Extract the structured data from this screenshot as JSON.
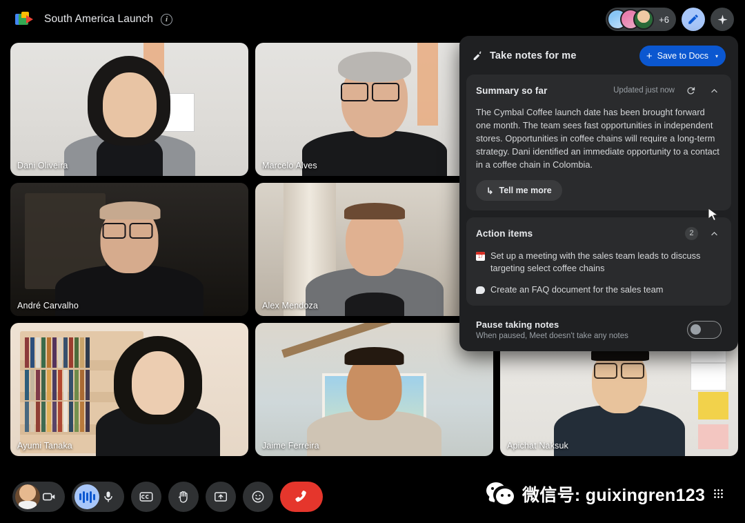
{
  "window": {
    "app_logo": "google-meet-logo",
    "title": "South America Launch",
    "info_icon": "info-icon"
  },
  "topbar": {
    "participant_overflow": "+6",
    "notes_toggle_icon": "notes-pen-icon",
    "gemini_icon": "sparkle-icon"
  },
  "grid": {
    "tiles": [
      {
        "name": "Dani Oliveira"
      },
      {
        "name": "Marcelo Alves"
      },
      {
        "name": "André Carvalho"
      },
      {
        "name": "Alex Mendoza"
      },
      {
        "name": "Ayumi Tanaka"
      },
      {
        "name": "Jaime Ferreira"
      },
      {
        "name": "Apichat Naksuk"
      }
    ]
  },
  "notes_panel": {
    "header_icon": "magic-pen-icon",
    "header_title": "Take notes for me",
    "save_button": {
      "plus": "+",
      "label": "Save to Docs",
      "caret": "▾"
    },
    "summary": {
      "title": "Summary so far",
      "updated": "Updated just now",
      "refresh_icon": "refresh-icon",
      "collapse_icon": "chevron-up-icon",
      "text": "The Cymbal Coffee launch date has been brought forward one month. The team sees fast opportunities in independent stores. Opportunities in coffee chains will require a long-term strategy. Dani identified an immediate opportunity to a contact in a coffee chain in Colombia.",
      "tell_me_more": {
        "arrow": "↳",
        "label": "Tell me more"
      }
    },
    "action_items": {
      "title": "Action items",
      "count": "2",
      "collapse_icon": "chevron-up-icon",
      "items": [
        {
          "icon": "calendar-icon",
          "day": "17",
          "text": "Set up a meeting with the sales team leads to discuss targeting select coffee chains"
        },
        {
          "icon": "chat-bubble-icon",
          "text": "Create an FAQ document for the sales team"
        }
      ]
    },
    "pause": {
      "title": "Pause taking notes",
      "subtitle": "When paused, Meet doesn't take any notes",
      "toggle_state": "off"
    }
  },
  "bottombar": {
    "camera": {
      "icon": "camera-icon",
      "name": "camera-toggle"
    },
    "microphone": {
      "icon": "microphone-icon",
      "name": "mic-toggle",
      "active_visualizer": "audio-wave-icon"
    },
    "captions": {
      "icon": "closed-captions-icon"
    },
    "raise_hand": {
      "icon": "raised-hand-icon"
    },
    "present": {
      "icon": "present-screen-icon"
    },
    "reactions": {
      "icon": "emoji-smile-icon"
    },
    "leave": {
      "icon": "hangup-phone-icon"
    }
  },
  "watermark": {
    "icon": "wechat-icon",
    "text": "微信号: guixingren123"
  },
  "colors": {
    "accent_blue": "#0b57d0",
    "active_blue": "#a8c7fa",
    "hangup_red": "#e5362c",
    "panel_bg": "#1f2022",
    "card_bg": "#2a2b2d"
  }
}
